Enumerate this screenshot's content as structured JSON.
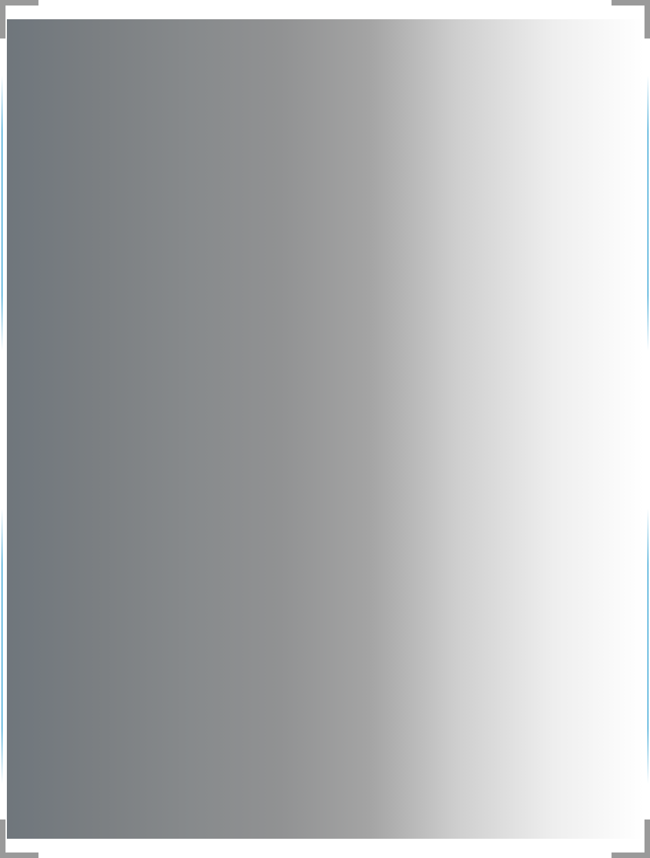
{
  "page": {
    "background_color": "#ffffff",
    "panel": {
      "gradient_colors": [
        "#6f767c",
        "#7b7f82",
        "#878a8c",
        "#919293",
        "#a4a4a4",
        "#cfcfcf",
        "#eeeeee",
        "#ffffff"
      ]
    },
    "corner_bracket_color": "#9a9a9a",
    "edge_line_color": "#5ab4dc"
  }
}
